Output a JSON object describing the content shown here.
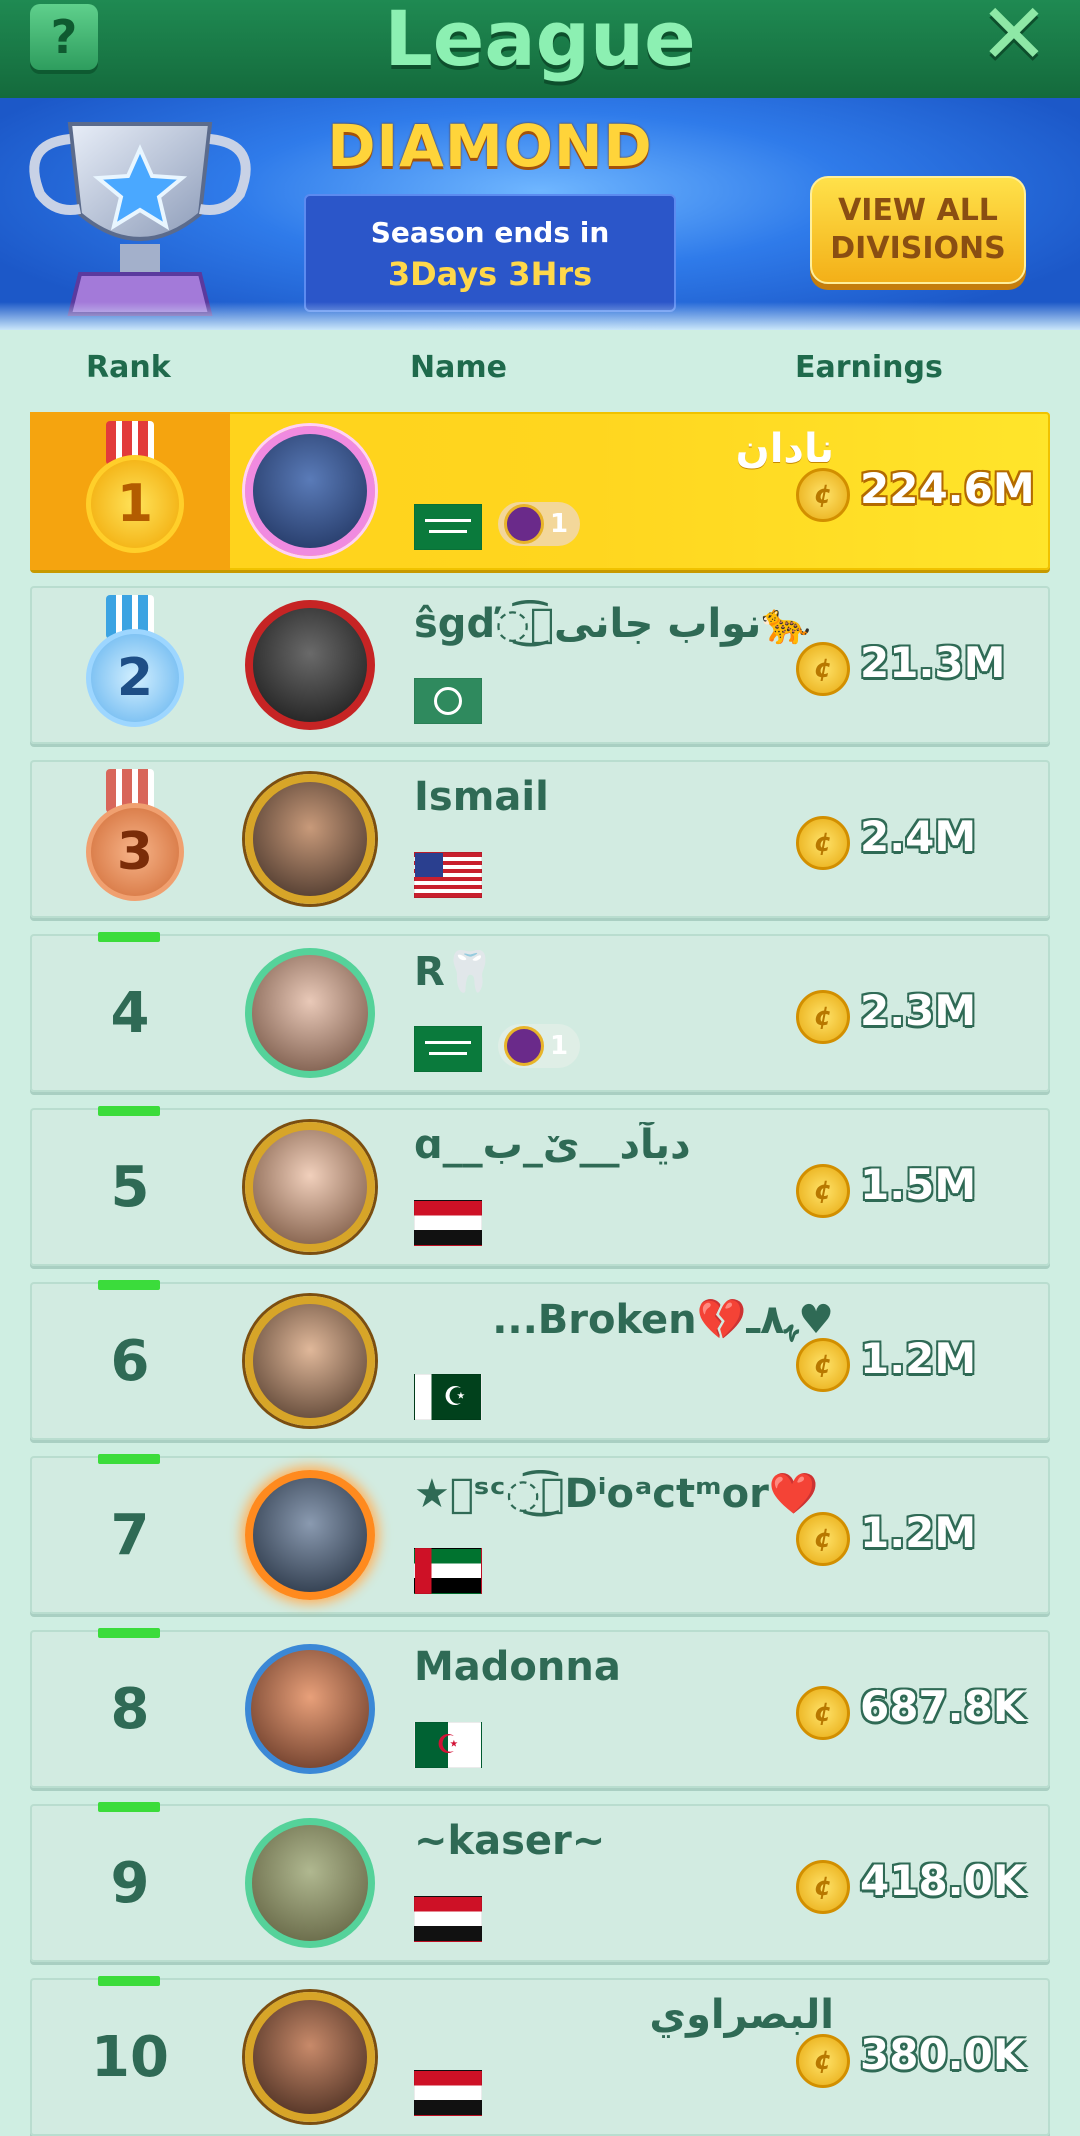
{
  "header": {
    "title": "League",
    "help_icon": "question-card-icon",
    "close_icon": "close-icon"
  },
  "banner": {
    "division": "DIAMOND",
    "season_label": "Season ends in",
    "season_value": "3Days 3Hrs",
    "view_all_line1": "VIEW ALL",
    "view_all_line2": "DIVISIONS"
  },
  "columns": {
    "rank": "Rank",
    "name": "Name",
    "earnings": "Earnings"
  },
  "rows": [
    {
      "rank": "1",
      "name": "نادان",
      "flag": "saudi-arabia",
      "badge": "1",
      "earnings": "224.6M"
    },
    {
      "rank": "2",
      "name": "ŝgď◌ٖ͜͡نواب جانی🐆",
      "flag": "globe",
      "badge": "",
      "earnings": "21.3M"
    },
    {
      "rank": "3",
      "name": "Ismail",
      "flag": "united-states",
      "badge": "",
      "earnings": "2.4M"
    },
    {
      "rank": "4",
      "name": "R🦷",
      "flag": "saudi-arabia",
      "badge": "1",
      "earnings": "2.3M"
    },
    {
      "rank": "5",
      "name": "ɑ__ديآد__ێ_ب",
      "flag": "iraq",
      "badge": "",
      "earnings": "1.5M"
    },
    {
      "rank": "6",
      "name": "♥ﮩ٨ـ💔Broken...",
      "flag": "pakistan",
      "badge": "",
      "earnings": "1.2M"
    },
    {
      "rank": "7",
      "name": "★⃝ˢᶜ◌ٖ͜͡Dⁱoᵃctᵐor❤️",
      "flag": "uae",
      "badge": "",
      "earnings": "1.2M"
    },
    {
      "rank": "8",
      "name": "Madonna",
      "flag": "algeria",
      "badge": "",
      "earnings": "687.8K"
    },
    {
      "rank": "9",
      "name": "~kaser~",
      "flag": "iraq",
      "badge": "",
      "earnings": "418.0K"
    },
    {
      "rank": "10",
      "name": "البصراوي",
      "flag": "iraq",
      "badge": "",
      "earnings": "380.0K"
    }
  ],
  "colors": {
    "header_green": "#146a3c",
    "row_bg": "#d2ebe1",
    "gold": "#ffd11a",
    "text_green": "#2f6a55"
  }
}
